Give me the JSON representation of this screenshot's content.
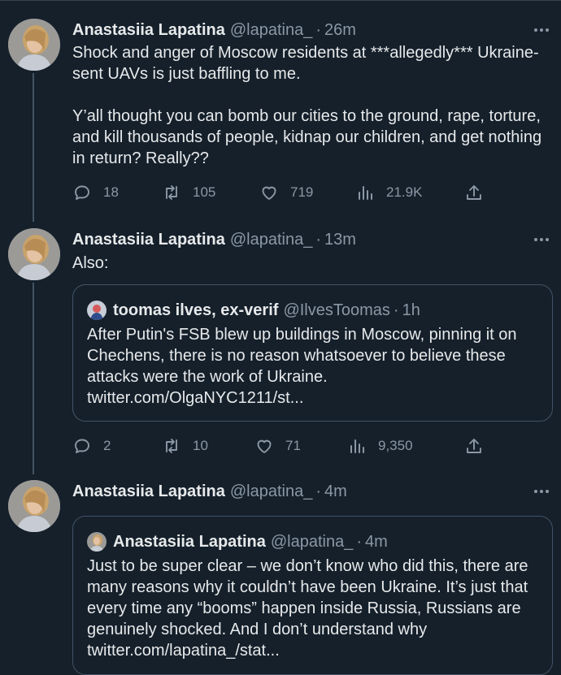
{
  "tweets": [
    {
      "name": "Anastasiia Lapatina",
      "handle": "@lapatina_",
      "dot": "·",
      "time": "26m",
      "text": "Shock and anger of Moscow residents at ***allegedly*** Ukraine-sent UAVs is just baffling to me.\n\nY’all thought you can bomb our cities to the ground, rape, torture, and kill thousands of people, kidnap our children, and get nothing in return? Really??",
      "replies": "18",
      "retweets": "105",
      "likes": "719",
      "views": "21.9K"
    },
    {
      "name": "Anastasiia Lapatina",
      "handle": "@lapatina_",
      "dot": "·",
      "time": "13m",
      "text": "Also:",
      "quote": {
        "name": "toomas ilves, ex-verif",
        "handle": "@IlvesToomas",
        "dot": "·",
        "time": "1h",
        "text": "After Putin's FSB blew up buildings in Moscow, pinning it on Chechens, there is no reason whatsoever to believe these attacks were the work of Ukraine.",
        "link": "twitter.com/OlgaNYC1211/st..."
      },
      "replies": "2",
      "retweets": "10",
      "likes": "71",
      "views": "9,350"
    },
    {
      "name": "Anastasiia Lapatina",
      "handle": "@lapatina_",
      "dot": "·",
      "time": "4m",
      "quote": {
        "name": "Anastasiia Lapatina",
        "handle": "@lapatina_",
        "dot": "·",
        "time": "4m",
        "text": "Just to be super clear – we don’t know who did this, there are many reasons why it couldn’t have been Ukraine. It’s just that  every time any “booms” happen inside Russia, Russians are genuinely shocked. And I don’t understand why twitter.com/lapatina_/stat..."
      }
    }
  ]
}
